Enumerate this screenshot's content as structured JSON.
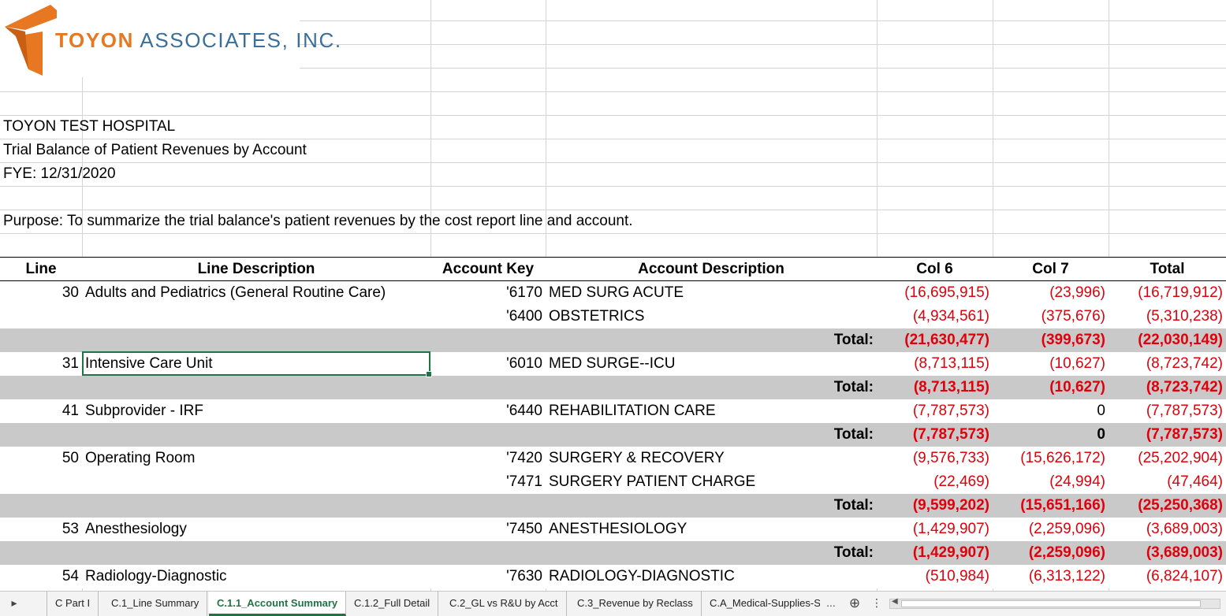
{
  "logo": {
    "brand": "TOYON",
    "rest": " ASSOCIATES, INC."
  },
  "info": {
    "hospital": "TOYON TEST HOSPITAL",
    "report": "Trial Balance of Patient Revenues by Account",
    "fye": "FYE: 12/31/2020",
    "purpose": "Purpose: To summarize the trial balance's patient revenues by the cost report line and account."
  },
  "headers": {
    "line": "Line",
    "line_desc": "Line Description",
    "account_key": "Account Key",
    "account_desc": "Account Description",
    "col6": "Col 6",
    "col7": "Col 7",
    "total": "Total"
  },
  "rows": [
    {
      "type": "data",
      "line": "30",
      "line_desc": "Adults and Pediatrics (General Routine Care)",
      "account_key": "'6170",
      "account_desc": "MED SURG ACUTE",
      "col6": "(16,695,915)",
      "col7": "(23,996)",
      "total": "(16,719,912)"
    },
    {
      "type": "data",
      "line": "",
      "line_desc": "",
      "account_key": "'6400",
      "account_desc": "OBSTETRICS",
      "col6": "(4,934,561)",
      "col7": "(375,676)",
      "total": "(5,310,238)"
    },
    {
      "type": "total",
      "label": "Total:",
      "col6": "(21,630,477)",
      "col7": "(399,673)",
      "total": "(22,030,149)"
    },
    {
      "type": "data",
      "line": "31",
      "line_desc": "Intensive Care Unit",
      "account_key": "'6010",
      "account_desc": "MED SURGE--ICU",
      "col6": "(8,713,115)",
      "col7": "(10,627)",
      "total": "(8,723,742)"
    },
    {
      "type": "total",
      "label": "Total:",
      "col6": "(8,713,115)",
      "col7": "(10,627)",
      "total": "(8,723,742)"
    },
    {
      "type": "data",
      "line": "41",
      "line_desc": "Subprovider - IRF",
      "account_key": "'6440",
      "account_desc": "REHABILITATION CARE",
      "col6": "(7,787,573)",
      "col7": "0",
      "total": "(7,787,573)"
    },
    {
      "type": "total",
      "label": "Total:",
      "col6": "(7,787,573)",
      "col7": "0",
      "total": "(7,787,573)"
    },
    {
      "type": "data",
      "line": "50",
      "line_desc": "Operating Room",
      "account_key": "'7420",
      "account_desc": "SURGERY & RECOVERY",
      "col6": "(9,576,733)",
      "col7": "(15,626,172)",
      "total": "(25,202,904)"
    },
    {
      "type": "data",
      "line": "",
      "line_desc": "",
      "account_key": "'7471",
      "account_desc": "SURGERY PATIENT CHARGE",
      "col6": "(22,469)",
      "col7": "(24,994)",
      "total": "(47,464)"
    },
    {
      "type": "total",
      "label": "Total:",
      "col6": "(9,599,202)",
      "col7": "(15,651,166)",
      "total": "(25,250,368)"
    },
    {
      "type": "data",
      "line": "53",
      "line_desc": "Anesthesiology",
      "account_key": "'7450",
      "account_desc": "ANESTHESIOLOGY",
      "col6": "(1,429,907)",
      "col7": "(2,259,096)",
      "total": "(3,689,003)"
    },
    {
      "type": "total",
      "label": "Total:",
      "col6": "(1,429,907)",
      "col7": "(2,259,096)",
      "total": "(3,689,003)"
    },
    {
      "type": "data",
      "line": "54",
      "line_desc": "Radiology-Diagnostic",
      "account_key": "'7630",
      "account_desc": "RADIOLOGY-DIAGNOSTIC",
      "col6": "(510,984)",
      "col7": "(6,313,122)",
      "total": "(6,824,107)"
    }
  ],
  "tabs": [
    {
      "label": "C Part I",
      "active": false
    },
    {
      "label": "C.1_Line Summary",
      "active": false
    },
    {
      "label": "C.1.1_Account Summary",
      "active": true
    },
    {
      "label": "C.1.2_Full Detail",
      "active": false
    },
    {
      "label": "C.2_GL vs R&U by Acct",
      "active": false
    },
    {
      "label": "C.3_Revenue by Reclass",
      "active": false
    },
    {
      "label": "C.A_Medical-Supplies-Sc",
      "active": false
    }
  ],
  "tabbar": {
    "ellipsis": "...",
    "more": "⋮",
    "add": "⊕",
    "scroll_left": "◀",
    "play": "▸"
  },
  "colors": {
    "accent": "#217346",
    "negative": "#e0000b",
    "total_band": "#c9c9c9",
    "brand_orange": "#e87722",
    "brand_blue": "#3a6f9c"
  }
}
